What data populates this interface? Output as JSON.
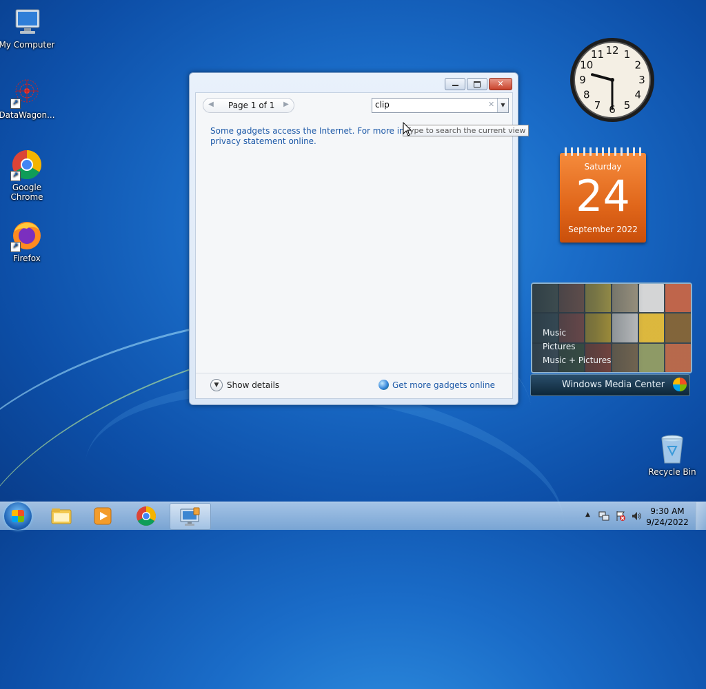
{
  "desktop": {
    "icons": [
      {
        "label": "My Computer",
        "icon": "computer-icon"
      },
      {
        "label": "DataWagon...",
        "icon": "datawagon-icon"
      },
      {
        "label": "Google Chrome",
        "icon": "chrome-icon"
      },
      {
        "label": "Firefox",
        "icon": "firefox-icon"
      },
      {
        "label": "Recycle Bin",
        "icon": "recycle-bin-icon"
      }
    ]
  },
  "gadget_window": {
    "pager": {
      "label": "Page 1 of 1"
    },
    "search": {
      "value": "clip",
      "tooltip": "Type to search the current view"
    },
    "info_text": "Some gadgets access the Internet.  For more information, see the privacy statement online.",
    "show_details": "Show details",
    "get_more": "Get more gadgets online"
  },
  "clock": {
    "numbers": [
      "12",
      "1",
      "2",
      "3",
      "4",
      "5",
      "6",
      "7",
      "8",
      "9",
      "10",
      "11"
    ],
    "hour": 9,
    "minute": 30
  },
  "calendar": {
    "weekday": "Saturday",
    "day": "24",
    "month_year": "September 2022"
  },
  "media_center": {
    "menu": [
      "Music",
      "Pictures",
      "Music + Pictures"
    ],
    "title": "Windows Media Center"
  },
  "taskbar": {
    "time": "9:30 AM",
    "date": "9/24/2022"
  },
  "colors": {
    "accent": "#1e5aa8",
    "calendar": "#e0661a"
  }
}
